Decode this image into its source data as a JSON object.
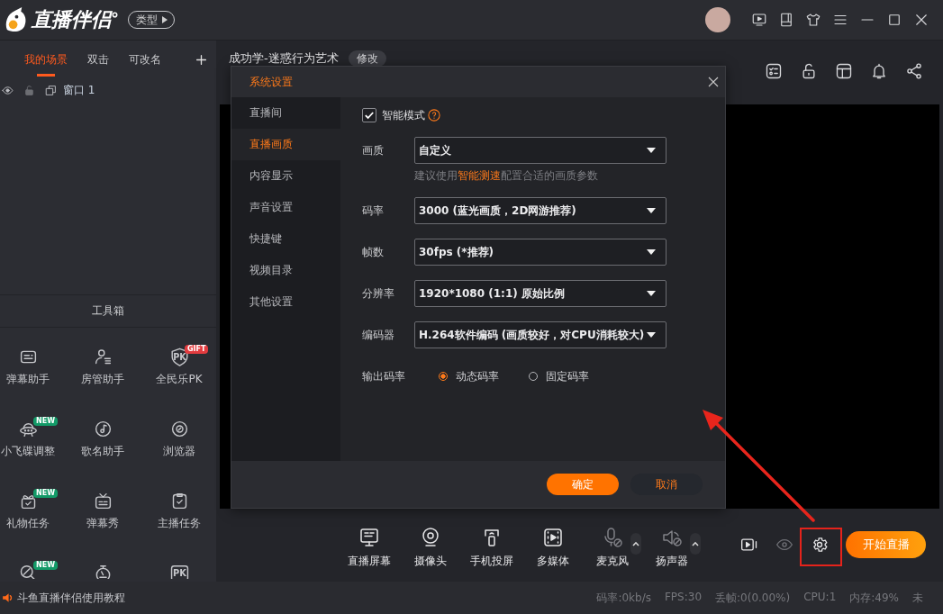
{
  "app": {
    "logo": "直播伴侣",
    "type_button": "类型"
  },
  "scene_tabs": [
    {
      "label": "我的场景",
      "selected": true
    },
    {
      "label": "双击",
      "selected": false
    },
    {
      "label": "可改名",
      "selected": false
    }
  ],
  "sources": [
    {
      "name": "窗口 1",
      "visible": true,
      "locked": false
    }
  ],
  "toolbox": {
    "title": "工具箱",
    "tools": [
      {
        "kind": "full",
        "label": "弹幕助手"
      },
      {
        "kind": "full",
        "label": "房管助手"
      },
      {
        "kind": "full",
        "label": "全民乐PK",
        "icon_text": "PK",
        "badge": {
          "text": "GIFT",
          "color": "#e23b3f"
        }
      },
      {
        "kind": "full",
        "label": "小飞碟调整",
        "badge": {
          "text": "NEW",
          "color": "#139a68"
        }
      },
      {
        "kind": "full",
        "label": "歌名助手"
      },
      {
        "kind": "full",
        "label": "浏览器"
      },
      {
        "kind": "full",
        "label": "礼物任务",
        "badge": {
          "text": "NEW",
          "color": "#139a68"
        }
      },
      {
        "kind": "full",
        "label": "弹幕秀"
      },
      {
        "kind": "full",
        "label": "主播任务"
      },
      {
        "kind": "clipped",
        "badge": {
          "text": "NEW",
          "color": "#139a68"
        }
      },
      {
        "kind": "clipped"
      },
      {
        "kind": "clipped",
        "icon_text": "PK"
      }
    ]
  },
  "scene": {
    "title": "成功学-迷惑行为艺术",
    "edit_button": "修改"
  },
  "dialog": {
    "title": "系统设置",
    "nav": [
      {
        "label": "直播间",
        "selected": false
      },
      {
        "label": "直播画质",
        "selected": true
      },
      {
        "label": "内容显示",
        "selected": false
      },
      {
        "label": "声音设置",
        "selected": false
      },
      {
        "label": "快捷键",
        "selected": false
      },
      {
        "label": "视频目录",
        "selected": false
      },
      {
        "label": "其他设置",
        "selected": false
      }
    ],
    "smart_mode": {
      "label": "智能模式",
      "checked": true
    },
    "fields": [
      {
        "label": "画质",
        "value": "自定义",
        "hint": {
          "before": "建议使用",
          "link": "智能测速",
          "after": "配置合适的画质参数"
        }
      },
      {
        "label": "码率",
        "value": "3000 (蓝光画质，2D网游推荐)"
      },
      {
        "label": "帧数",
        "value": "30fps (*推荐)"
      },
      {
        "label": "分辨率",
        "value": "1920*1080 (1:1) 原始比例"
      },
      {
        "label": "编码器",
        "value": "H.264软件编码 (画质较好，对CPU消耗较大)"
      }
    ],
    "output_bitrate": {
      "label": "输出码率",
      "options": [
        {
          "label": "动态码率",
          "selected": true
        },
        {
          "label": "固定码率",
          "selected": false
        }
      ]
    },
    "confirm_button": "确定",
    "cancel_button": "取消"
  },
  "toolbar": {
    "items": [
      {
        "kind": "source",
        "label": "直播屏幕"
      },
      {
        "kind": "source",
        "label": "摄像头"
      },
      {
        "kind": "source",
        "label": "手机投屏"
      },
      {
        "kind": "source",
        "label": "多媒体"
      },
      {
        "kind": "device",
        "label": "麦克风",
        "muted": true
      },
      {
        "kind": "device",
        "label": "扬声器",
        "muted": true
      }
    ],
    "start_button": "开始直播"
  },
  "status_bar": {
    "tutorial": "斗鱼直播伴侣使用教程",
    "stats": [
      "码率:0kb/s",
      "FPS:30",
      "丢帧:0(0.00%)",
      "CPU:1",
      "内存:49%",
      "未"
    ]
  }
}
